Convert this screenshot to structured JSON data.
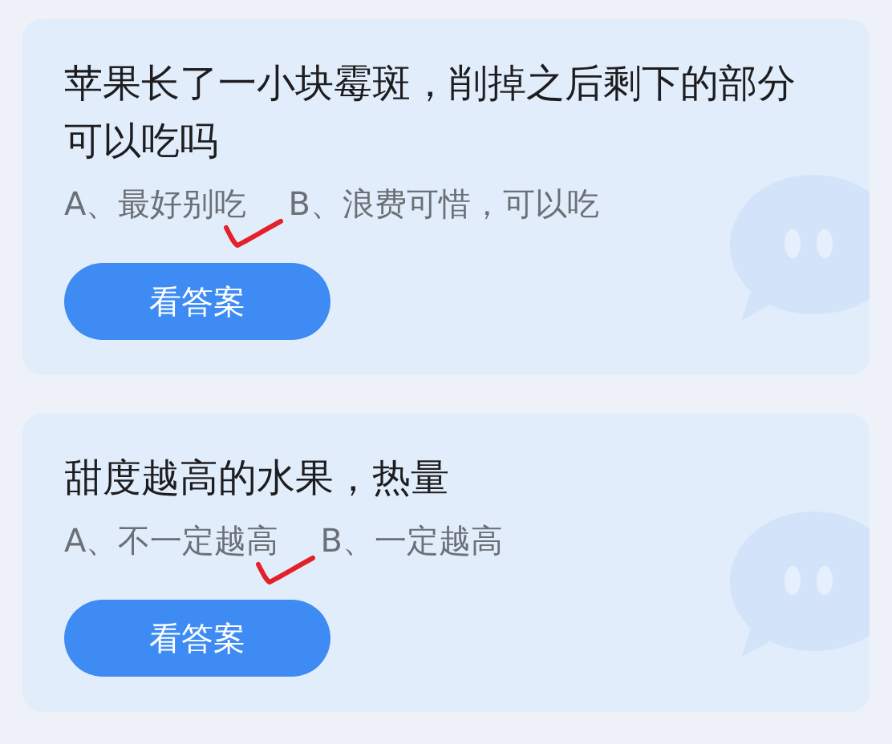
{
  "questions": [
    {
      "title": "苹果长了一小块霉斑，削掉之后剩下的部分可以吃吗",
      "options": [
        {
          "text": "A、最好别吃",
          "selected": true
        },
        {
          "text": "B、浪费可惜，可以吃",
          "selected": false
        }
      ],
      "button": "看答案"
    },
    {
      "title": "甜度越高的水果，热量",
      "options": [
        {
          "text": "A、不一定越高",
          "selected": true
        },
        {
          "text": "B、一定越高",
          "selected": false
        }
      ],
      "button": "看答案"
    }
  ]
}
